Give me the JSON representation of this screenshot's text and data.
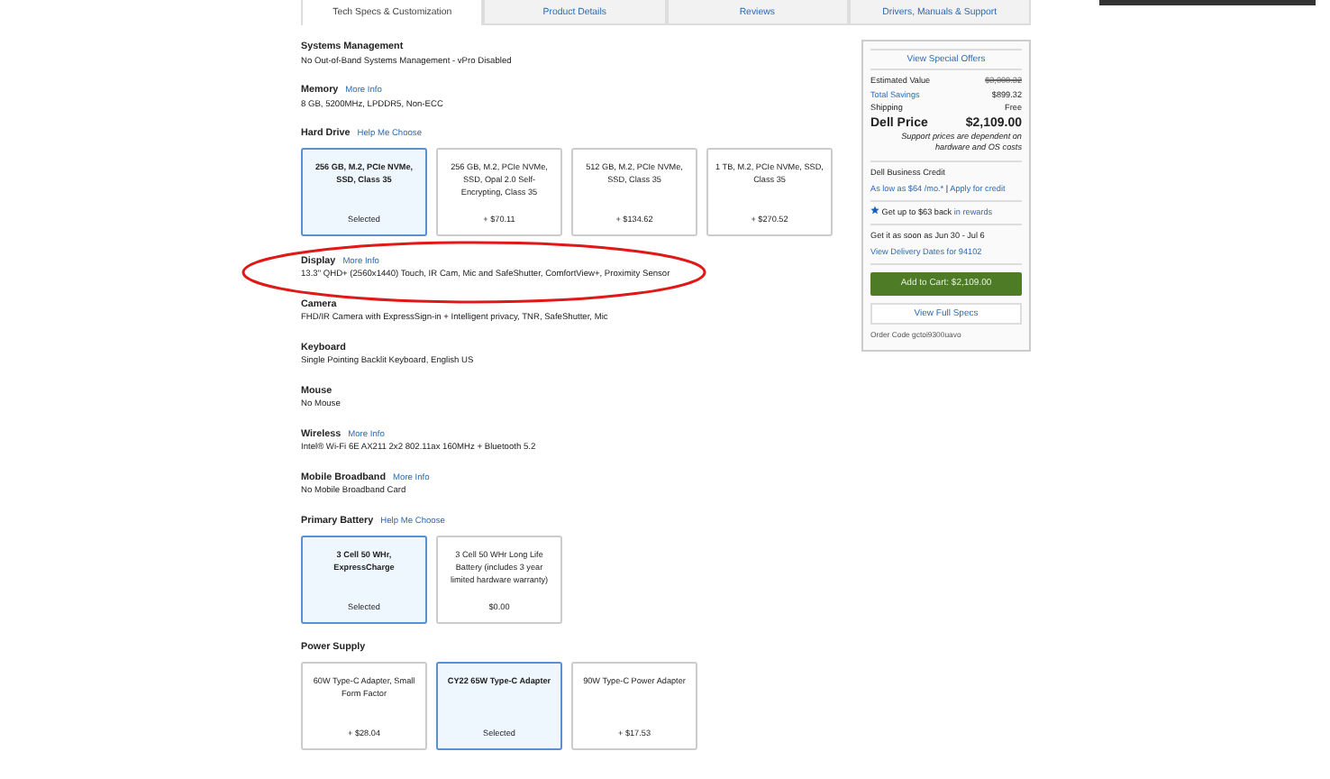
{
  "tabs": [
    {
      "label": "Tech Specs & Customization",
      "selected": true
    },
    {
      "label": "Product Details",
      "selected": false
    },
    {
      "label": "Reviews",
      "selected": false
    },
    {
      "label": "Drivers, Manuals & Support",
      "selected": false
    }
  ],
  "sections": [
    {
      "title": "Systems Management",
      "value": "No Out-of-Band Systems Management - vPro Disabled"
    },
    {
      "title": "Memory",
      "link": "More Info",
      "value": "8 GB, 5200MHz, LPDDR5, Non-ECC"
    },
    {
      "title": "Hard Drive",
      "link": "Help Me Choose",
      "options": [
        {
          "text": "256 GB, M.2, PCIe NVMe, SSD, Class 35",
          "price": "Selected",
          "selected": true
        },
        {
          "text": "256 GB, M.2, PCIe NVMe, SSD, Opal 2.0 Self-Encrypting, Class 35",
          "price": "+ $70.11",
          "selected": false
        },
        {
          "text": "512 GB, M.2, PCIe NVMe, SSD, Class 35",
          "price": "+ $134.62",
          "selected": false
        },
        {
          "text": "1 TB, M.2, PCIe NVMe, SSD, Class 35",
          "price": "+ $270.52",
          "selected": false
        }
      ]
    },
    {
      "title": "Display",
      "link": "More Info",
      "value": "13.3\" QHD+ (2560x1440) Touch, IR Cam, Mic and SafeShutter, ComfortView+, Proximity Sensor",
      "circled": true
    },
    {
      "title": "Camera",
      "value": "FHD/IR Camera with ExpressSign-in + Intelligent privacy, TNR, SafeShutter, Mic"
    },
    {
      "title": "Keyboard",
      "value": "Single Pointing Backlit Keyboard, English US"
    },
    {
      "title": "Mouse",
      "value": "No Mouse"
    },
    {
      "title": "Wireless",
      "link": "More Info",
      "value": "Intel® Wi-Fi 6E AX211 2x2 802.11ax 160MHz + Bluetooth 5.2"
    },
    {
      "title": "Mobile Broadband",
      "link": "More Info",
      "value": "No Mobile Broadband Card"
    },
    {
      "title": "Primary Battery",
      "link": "Help Me Choose",
      "options": [
        {
          "text": "3 Cell 50 WHr, ExpressCharge",
          "price": "Selected",
          "selected": true
        },
        {
          "text": "3 Cell 50 WHr Long Life Battery (includes 3 year limited hardware warranty)",
          "price": "$0.00",
          "selected": false
        }
      ]
    },
    {
      "title": "Power Supply",
      "options": [
        {
          "text": "60W Type-C Adapter, Small Form Factor",
          "price": "+ $28.04",
          "selected": false
        },
        {
          "text": "CY22 65W Type-C Adapter",
          "price": "Selected",
          "selected": true
        },
        {
          "text": "90W Type-C Power Adapter",
          "price": "+ $17.53",
          "selected": false
        }
      ]
    }
  ],
  "summary": {
    "offers_link": "View Special Offers",
    "lines": [
      {
        "label": "Estimated Value",
        "value": "$3,008.32",
        "kind": "struck"
      },
      {
        "label": "Total Savings",
        "value": "$899.32",
        "kind": "link"
      },
      {
        "label": "Shipping",
        "value": "Free",
        "kind": "plain"
      }
    ],
    "price_label": "Dell Price",
    "price": "$2,109.00",
    "note": "Support prices are dependent on hardware and OS costs",
    "credit_title": "Dell Business Credit",
    "credit_link": "As low as $64 /mo.*",
    "credit_sep": "|",
    "credit_apply": "Apply for credit",
    "rewards_text": "Get up to $63 back",
    "rewards_link": "in rewards",
    "delivery": "Get it as soon as Jun 30 - Jul 6",
    "delivery_link": "View Delivery Dates for 94102",
    "add_to_cart": "Add to Cart: $2,109.00",
    "full_specs": "View Full Specs",
    "order_code": "Order Code gctoi9300uavo"
  }
}
